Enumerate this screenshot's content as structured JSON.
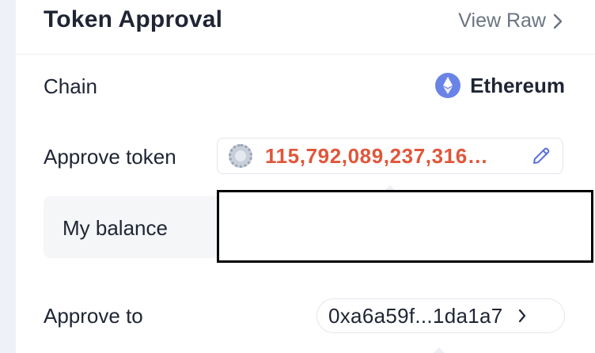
{
  "header": {
    "title": "Token Approval",
    "view_raw_label": "View Raw"
  },
  "rows": {
    "chain": {
      "label": "Chain",
      "value": "Ethereum",
      "icon": "ethereum-icon"
    },
    "approve_token": {
      "label": "Approve token",
      "amount": "115,792,089,237,316…",
      "icon": "token-icon",
      "edit_icon": "pencil-icon"
    },
    "my_balance": {
      "label": "My balance"
    },
    "approve_to": {
      "label": "Approve to",
      "address": "0xa6a59f...1da1a7"
    }
  },
  "colors": {
    "amount": "#e0563a",
    "eth_badge": "#6a83e6",
    "text": "#1f2533",
    "muted": "#6b7480"
  }
}
